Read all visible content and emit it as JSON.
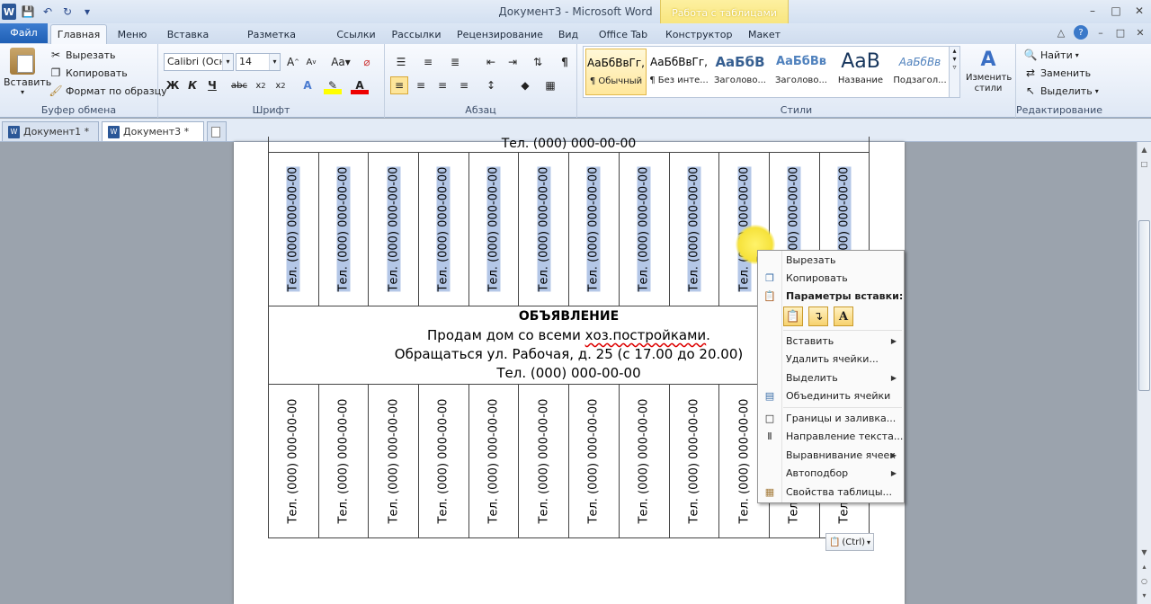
{
  "app": {
    "title": "Документ3 - Microsoft Word",
    "logo": "W",
    "context_group": "Работа с таблицами"
  },
  "qat": {
    "icons": [
      "save-icon",
      "undo-icon",
      "redo-icon",
      "customize-icon"
    ]
  },
  "tabs": {
    "file": "Файл",
    "home": "Главная",
    "items": [
      "Меню",
      "Вставка",
      "Разметка страницы",
      "Ссылки",
      "Рассылки",
      "Рецензирование",
      "Вид",
      "Office Tab",
      "Конструктор",
      "Макет"
    ]
  },
  "clipboard": {
    "paste": "Вставить",
    "cut": "Вырезать",
    "copy": "Копировать",
    "format_painter": "Формат по образцу",
    "label": "Буфер обмена"
  },
  "font": {
    "family": "Calibri (Осно",
    "size": "14",
    "label": "Шрифт",
    "bold": "Ж",
    "italic": "К",
    "underline": "Ч",
    "case": "Aa"
  },
  "paragraph": {
    "label": "Абзац"
  },
  "styles": {
    "label": "Стили",
    "items": [
      {
        "preview": "АаБбВвГг,",
        "name": "¶ Обычный"
      },
      {
        "preview": "АаБбВвГг,",
        "name": "¶ Без инте..."
      },
      {
        "preview": "АаБбВ",
        "name": "Заголово..."
      },
      {
        "preview": "АаБбВв",
        "name": "Заголово..."
      },
      {
        "preview": "АаВ",
        "name": "Название"
      },
      {
        "preview": "АаБбВв",
        "name": "Подзагол..."
      }
    ],
    "change": "Изменить стили"
  },
  "editing": {
    "find": "Найти",
    "replace": "Заменить",
    "select": "Выделить",
    "label": "Редактирование"
  },
  "doctabs": [
    {
      "label": "Документ1 *"
    },
    {
      "label": "Документ3 *"
    }
  ],
  "document": {
    "phone": "Тел. (000) 000-00-00",
    "ad_title": "ОБЪЯВЛЕНИЕ",
    "ad_line1_a": "Продам дом со всеми ",
    "ad_line1_b": "хоз.постройками",
    "ad_line1_c": ".",
    "ad_line2": "Обращаться ул. Рабочая, д. 25 (с 17.00 до 20.00)",
    "ad_line3": "Тел. (000) 000-00-00"
  },
  "context_menu": {
    "cut": "Вырезать",
    "copy": "Копировать",
    "paste_options": "Параметры вставки:",
    "insert": "Вставить",
    "delete_cells": "Удалить ячейки...",
    "select": "Выделить",
    "merge_cells": "Объединить ячейки",
    "borders": "Границы и заливка...",
    "text_direction": "Направление текста...",
    "cell_alignment": "Выравнивание ячеек",
    "autofit": "Автоподбор",
    "table_properties": "Свойства таблицы..."
  },
  "paste_chip": "(Ctrl)"
}
